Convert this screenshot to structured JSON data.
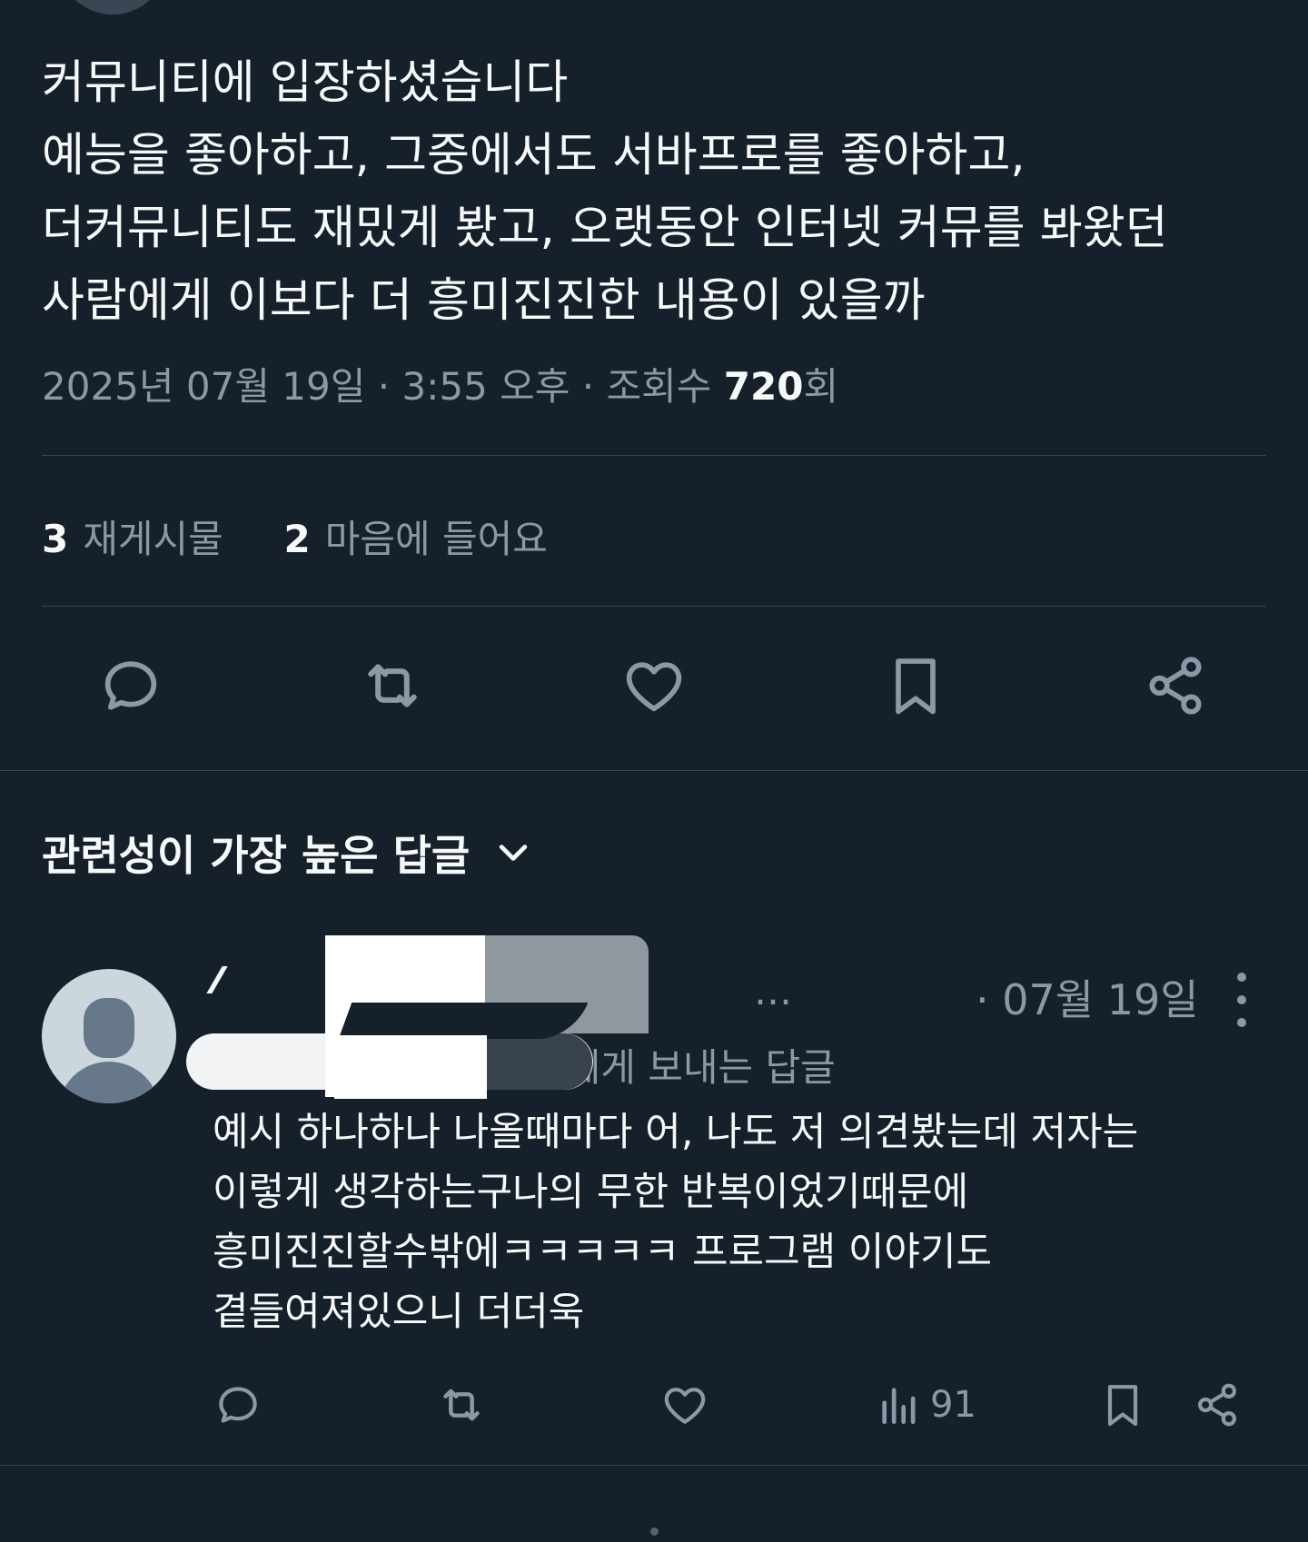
{
  "tweet": {
    "lines": [
      "커뮤니티에 입장하셨습니다",
      "예능을 좋아하고, 그중에서도 서바프로를 좋아하고,",
      "더커뮤니티도 재밌게 봤고, 오랫동안 인터넷 커뮤를 봐왔던",
      "사람에게 이보다 더 흥미진진한 내용이 있을까"
    ],
    "date": "2025년 07월 19일",
    "sep": "·",
    "time": "3:55 오후",
    "views_label": "조회수",
    "views_count": "720",
    "views_suffix": "회"
  },
  "stats": {
    "reposts_count": "3",
    "reposts_label": "재게시물",
    "likes_count": "2",
    "likes_label": "마음에 들어요"
  },
  "icons": {
    "reply": "comment-icon",
    "repost": "repost-icon",
    "like": "heart-icon",
    "bookmark": "bookmark-icon",
    "share": "share-icon",
    "views": "bar-chart-icon",
    "more": "more-vertical-icon",
    "chevron": "chevron-down-icon"
  },
  "replies_section": {
    "title": "관련성이 가장 높은 답글"
  },
  "reply": {
    "handle_partial": "…",
    "sep": "·",
    "time": "07월 19일",
    "reply_to_suffix": "님에게 보내는 답글",
    "lines": [
      "예시 하나하나 나올때마다 어, 나도 저 의견봤는데 저자는",
      "이렇게 생각하는구나의 무한 반복이었기때문에",
      "흥미진진할수밖에ㅋㅋㅋㅋㅋ 프로그램 이야기도",
      "곁들여져있으니 더더욱"
    ],
    "views_count": "91"
  },
  "colors": {
    "background": "#15202b",
    "text": "#f7f9f9",
    "muted": "#8b98a5",
    "divider": "#38444d"
  }
}
